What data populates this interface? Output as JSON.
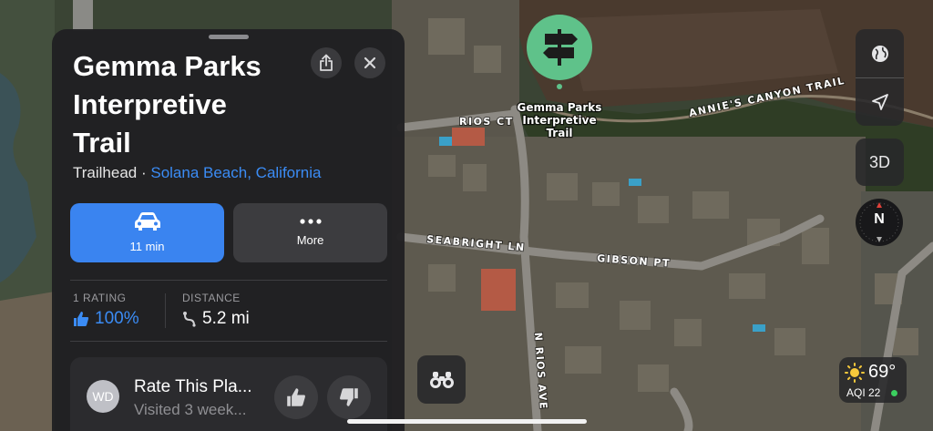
{
  "map": {
    "roads": {
      "annies_canyon": "ANNIE'S CANYON TRAIL",
      "rios_ct": "RIOS CT",
      "seabright": "SEABRIGHT LN",
      "gibson": "GIBSON PT",
      "n_rios": "N RIOS AVE"
    },
    "poi": {
      "icon": "signpost-icon",
      "color": "#5fc28a",
      "label_lines": [
        "Gemma Parks",
        "Interpretive",
        "Trail"
      ]
    }
  },
  "card": {
    "title": "Gemma Parks\nInterpretive\nTrail",
    "category": "Trailhead · ",
    "location": "Solana Beach, California",
    "share_icon": "share-icon",
    "close_icon": "close-icon",
    "drive": {
      "icon": "car-icon",
      "label": "11 min",
      "color": "#3a84f0"
    },
    "more": {
      "icon": "ellipsis-icon",
      "label": "More"
    },
    "ratings": {
      "label": "1 RATING",
      "value": "100%",
      "icon": "thumbs-up-icon"
    },
    "distance": {
      "label": "DISTANCE",
      "value": "5.2 mi",
      "icon": "route-icon"
    },
    "rate": {
      "avatar": "WD",
      "title": "Rate This Pla...",
      "subtitle": "Visited 3 week..."
    }
  },
  "controls": {
    "globe_icon": "globe-icon",
    "location_icon": "location-arrow-icon",
    "three_d": "3D",
    "compass": "N",
    "binoculars_icon": "binoculars-icon"
  },
  "weather": {
    "icon": "sun-icon",
    "temp": "69°",
    "aqi": "AQI 22",
    "aqi_color": "#3bcf5f"
  }
}
